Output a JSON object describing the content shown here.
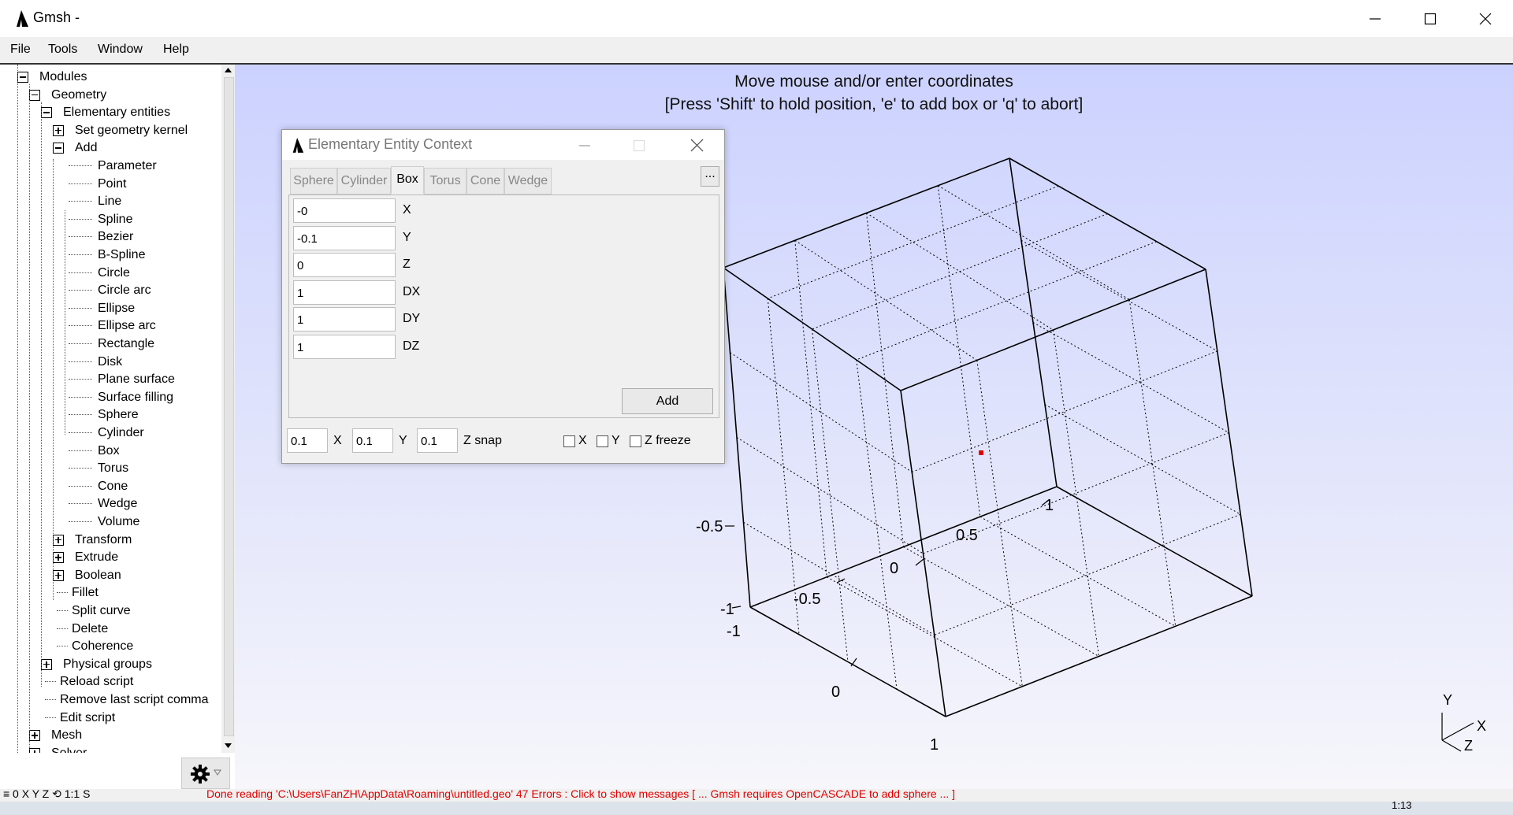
{
  "window": {
    "title": "Gmsh -"
  },
  "menu": [
    "File",
    "Tools",
    "Window",
    "Help"
  ],
  "tree": {
    "modules": "Modules",
    "geometry": "Geometry",
    "elementary": "Elementary entities",
    "set_kernel": "Set geometry kernel",
    "add": "Add",
    "add_items": [
      "Parameter",
      "Point",
      "Line",
      "Spline",
      "Bezier",
      "B-Spline",
      "Circle",
      "Circle arc",
      "Ellipse",
      "Ellipse arc",
      "Rectangle",
      "Disk",
      "Plane surface",
      "Surface filling",
      "Sphere",
      "Cylinder",
      "Box",
      "Torus",
      "Cone",
      "Wedge",
      "Volume"
    ],
    "transform": "Transform",
    "extrude": "Extrude",
    "boolean": "Boolean",
    "fillet": "Fillet",
    "split_curve": "Split curve",
    "delete": "Delete",
    "coherence": "Coherence",
    "physical_groups": "Physical groups",
    "reload_script": "Reload script",
    "remove_last": "Remove last script comma",
    "edit_script": "Edit script",
    "mesh": "Mesh",
    "solver": "Solver"
  },
  "viewport": {
    "message_line1": "Move mouse and/or enter coordinates",
    "message_line2": "[Press 'Shift' to hold position, 'e' to add box or 'q' to abort]",
    "axis_labels": [
      "-0.5",
      "0",
      "0.5",
      "1",
      "-1",
      "-1",
      "-0.5",
      "0",
      "1"
    ],
    "triad": {
      "y": "Y",
      "x": "X",
      "z": "Z"
    }
  },
  "dialog": {
    "title": "Elementary Entity Context",
    "tabs": [
      "Sphere",
      "Cylinder",
      "Box",
      "Torus",
      "Cone",
      "Wedge"
    ],
    "active_tab": "Box",
    "more_button": "...",
    "fields": [
      {
        "value": "-0",
        "label": "X"
      },
      {
        "value": "-0.1",
        "label": "Y"
      },
      {
        "value": "0",
        "label": "Z"
      },
      {
        "value": "1",
        "label": "DX"
      },
      {
        "value": "1",
        "label": "DY"
      },
      {
        "value": "1",
        "label": "DZ"
      }
    ],
    "add_button": "Add",
    "snap": {
      "x": "0.1",
      "x_label": "X",
      "y": "0.1",
      "y_label": "Y",
      "z": "0.1",
      "z_label": "Z snap"
    },
    "freeze": {
      "x": "X",
      "y": "Y",
      "z": "Z freeze"
    }
  },
  "status": {
    "left": "≡ 0 X Y Z ⟲ 1:1 S",
    "message": "Done reading 'C:\\Users\\FanZH\\AppData\\Roaming\\untitled.geo'    47 Errors : Click to show messages [ ...  Gmsh requires OpenCASCADE to add sphere ... ]",
    "message_color": "#e00000"
  },
  "taskbar": {
    "clock": "1:13"
  }
}
